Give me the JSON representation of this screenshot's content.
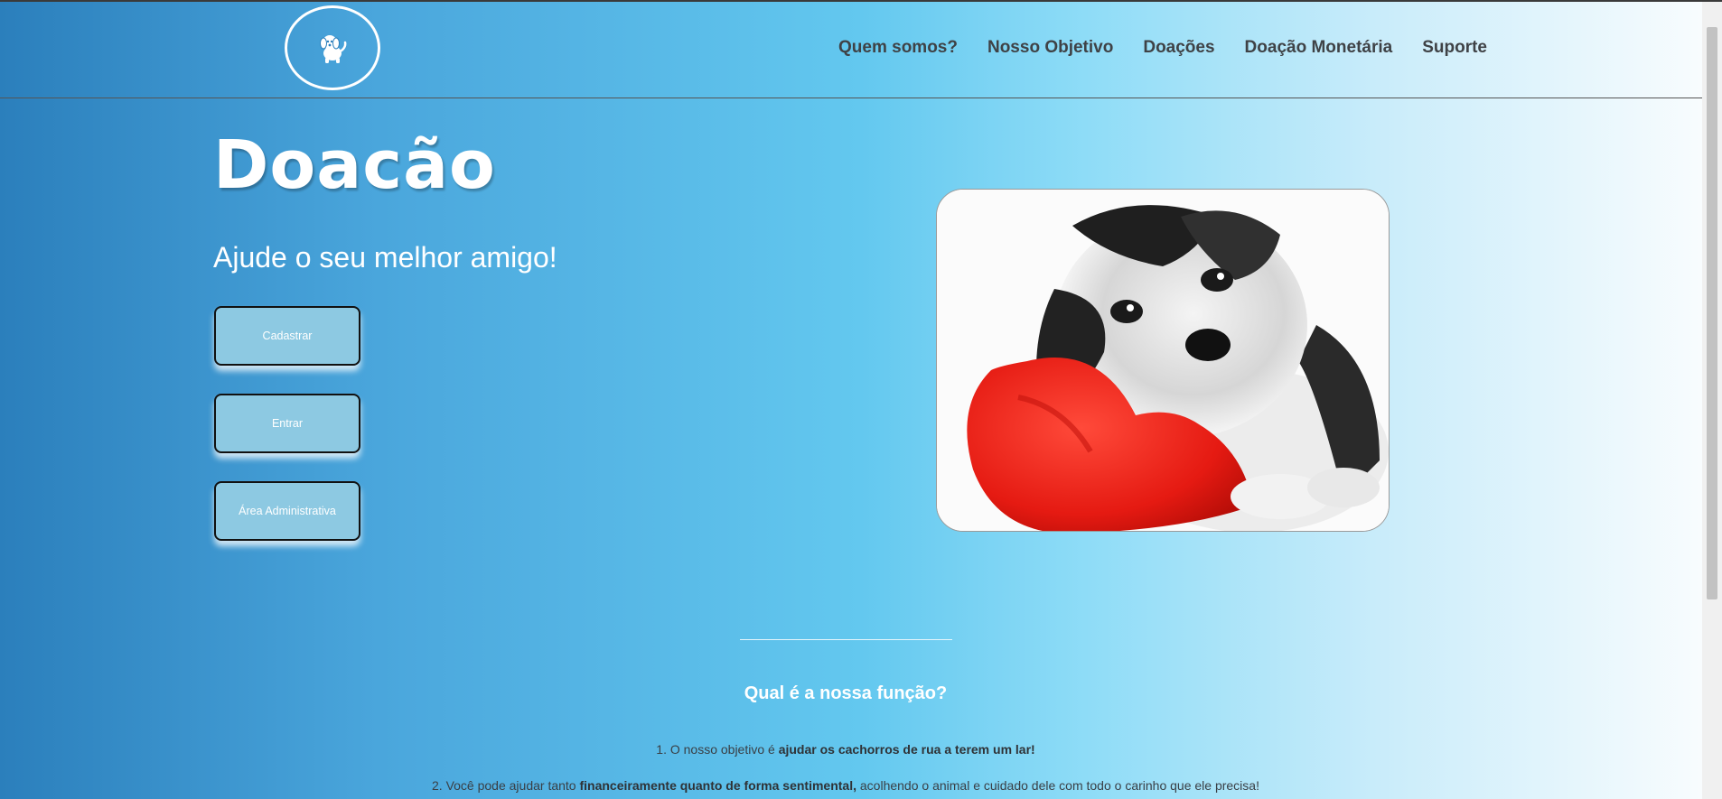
{
  "header": {
    "nav": [
      {
        "label": "Quem somos?"
      },
      {
        "label": "Nosso Objetivo"
      },
      {
        "label": "Doações"
      },
      {
        "label": "Doação Monetária"
      },
      {
        "label": "Suporte"
      }
    ],
    "logo_icon": "dog-icon"
  },
  "hero": {
    "title": "Doacão",
    "subtitle": "Ajude o seu melhor amigo!",
    "buttons": {
      "register": "Cadastrar",
      "login": "Entrar",
      "admin": "Área Administrativa"
    },
    "image": "puppy-with-red-heart-image"
  },
  "section": {
    "title": "Qual é a nossa função?",
    "item1": {
      "prefix": "1. O nosso objetivo é ",
      "bold": "ajudar os cachorros de rua a terem um lar!"
    },
    "item2": {
      "prefix": "2. Você pode ajudar tanto ",
      "bold": "financeiramente quanto de forma sentimental,",
      "suffix": " acolhendo o animal e cuidado dele com todo o carinho que ele precisa!"
    }
  },
  "colors": {
    "gradient_start": "#2b7fbc",
    "gradient_mid": "#63c8ef",
    "gradient_end": "#fbfdfe",
    "button_bg": "#8dc9e2",
    "nav_text": "#3f4246"
  }
}
